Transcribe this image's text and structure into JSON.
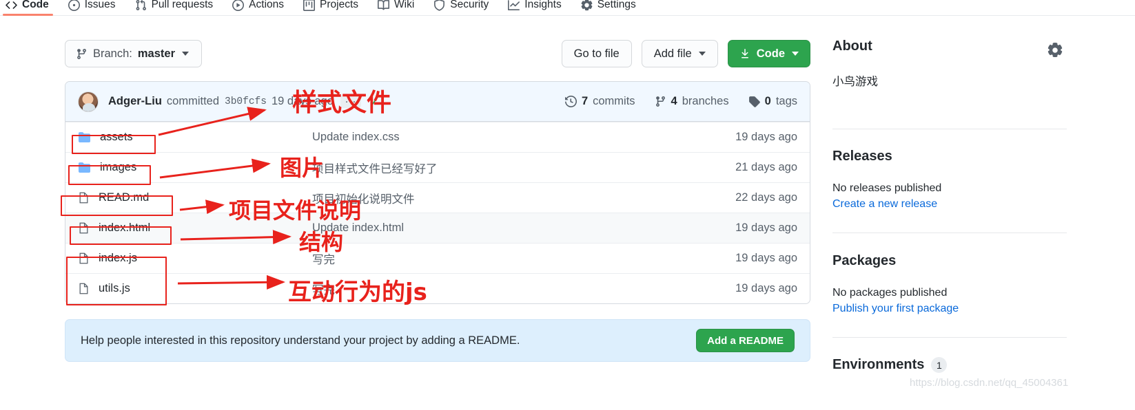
{
  "nav": {
    "items": [
      {
        "label": "Code",
        "icon": "code-icon",
        "active": true
      },
      {
        "label": "Issues",
        "icon": "issue-icon",
        "active": false
      },
      {
        "label": "Pull requests",
        "icon": "pull-request-icon",
        "active": false
      },
      {
        "label": "Actions",
        "icon": "play-icon",
        "active": false
      },
      {
        "label": "Projects",
        "icon": "project-icon",
        "active": false
      },
      {
        "label": "Wiki",
        "icon": "book-icon",
        "active": false
      },
      {
        "label": "Security",
        "icon": "shield-icon",
        "active": false
      },
      {
        "label": "Insights",
        "icon": "graph-icon",
        "active": false
      },
      {
        "label": "Settings",
        "icon": "gear-icon",
        "active": false
      }
    ]
  },
  "toolbar": {
    "branch_prefix": "Branch:",
    "branch_name": "master",
    "go_to_file": "Go to file",
    "add_file": "Add file",
    "code": "Code"
  },
  "commit": {
    "author": "Adger-Liu",
    "verb": "committed",
    "sha": "3b0fcfs",
    "time": "19 days ago",
    "more": "...",
    "commits_count": "7",
    "commits_label": "commits",
    "branches_count": "4",
    "branches_label": "branches",
    "tags_count": "0",
    "tags_label": "tags"
  },
  "files": [
    {
      "name": "assets",
      "type": "folder",
      "message": "Update index.css",
      "date": "19 days ago"
    },
    {
      "name": "images",
      "type": "folder",
      "message": "项目样式文件已经写好了",
      "date": "21 days ago"
    },
    {
      "name": "READ.md",
      "type": "file",
      "message": "项目初始化说明文件",
      "date": "22 days ago"
    },
    {
      "name": "index.html",
      "type": "file",
      "message": "Update index.html",
      "date": "19 days ago"
    },
    {
      "name": "index.js",
      "type": "file",
      "message": "写完",
      "date": "19 days ago"
    },
    {
      "name": "utils.js",
      "type": "file",
      "message": "写完",
      "date": "19 days ago"
    }
  ],
  "readme_banner": {
    "text": "Help people interested in this repository understand your project by adding a README.",
    "button": "Add a README"
  },
  "sidebar": {
    "about_title": "About",
    "about_description": "小鸟游戏",
    "releases_title": "Releases",
    "releases_empty": "No releases published",
    "releases_link": "Create a new release",
    "packages_title": "Packages",
    "packages_empty": "No packages published",
    "packages_link": "Publish your first package",
    "environments_title": "Environments",
    "environments_count": "1"
  },
  "annotations": [
    {
      "text": "样式文件",
      "meaning": "style file"
    },
    {
      "text": "图片",
      "meaning": "images"
    },
    {
      "text": "项目文件说明",
      "meaning": "project file description"
    },
    {
      "text": "结构",
      "meaning": "structure"
    },
    {
      "text": "互动行为的js",
      "meaning": "interaction behaviour js"
    }
  ],
  "watermark": "https://blog.csdn.net/qq_45004361",
  "colors": {
    "accent_green": "#2da44e",
    "link_blue": "#0969da",
    "annotation_red": "#e8221c",
    "active_tab": "#f9826c"
  }
}
